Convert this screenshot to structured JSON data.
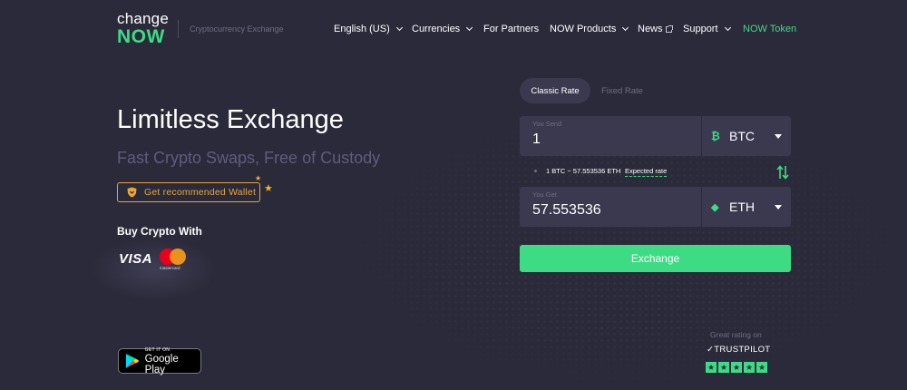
{
  "brand": {
    "logo_line1": "change",
    "logo_line2": "NOW",
    "tagline": "Cryptocurrency Exchange"
  },
  "nav": {
    "language": "English (US)",
    "currencies": "Currencies",
    "partners": "For Partners",
    "products": "NOW Products",
    "news": "News",
    "support": "Support",
    "token": "NOW Token"
  },
  "hero": {
    "title": "Limitless Exchange",
    "subtitle": "Fast Crypto Swaps, Free of Custody",
    "wallet_button": "Get recommended Wallet",
    "buy_with": "Buy Crypto With",
    "visa": "VISA",
    "mastercard": "mastercard"
  },
  "google_play": {
    "small": "GET IT ON",
    "big": "Google Play"
  },
  "exchange": {
    "tabs": {
      "classic": "Classic Rate",
      "fixed": "Fixed Rate"
    },
    "send": {
      "label": "You Send",
      "value": "1",
      "currency": "BTC",
      "icon": "₿"
    },
    "get": {
      "label": "You Get",
      "value": "57.553536",
      "currency": "ETH",
      "icon": "◆"
    },
    "rate_text": "1 BTC ~ 57.553536 ETH",
    "expected_rate": "Expected rate",
    "button": "Exchange"
  },
  "trustpilot": {
    "great": "Great rating on",
    "name": "TRUSTPILOT",
    "stars": 5
  },
  "colors": {
    "background": "#2b2a3a",
    "accent": "#3ddc84",
    "field": "#3a3950",
    "wallet": "#e8a53a",
    "btc": "#3ddc84",
    "eth": "#3ddc84"
  }
}
